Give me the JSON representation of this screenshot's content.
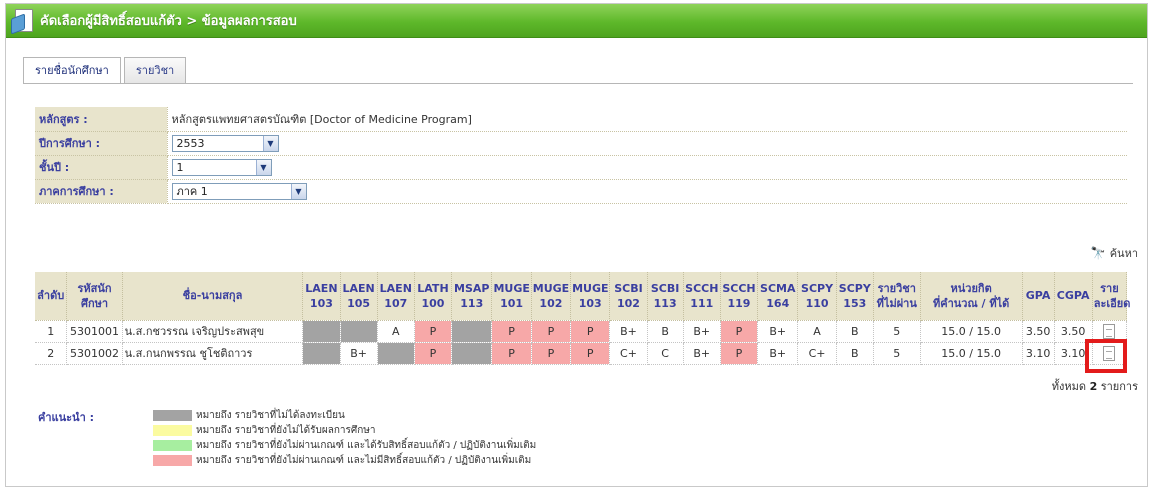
{
  "header": {
    "title": "คัดเลือกผู้มีสิทธิ์สอบแก้ตัว > ข้อมูลผลการสอบ"
  },
  "tabs": [
    {
      "label": "รายชื่อนักศึกษา",
      "active": true
    },
    {
      "label": "รายวิชา",
      "active": false
    }
  ],
  "form": {
    "curriculum_label": "หลักสูตร :",
    "curriculum_value": "หลักสูตรแพทยศาสตรบัณฑิต [Doctor of Medicine Program]",
    "year_label": "ปีการศึกษา :",
    "year_value": "2553",
    "class_label": "ชั้นปี :",
    "class_value": "1",
    "semester_label": "ภาคการศึกษา :",
    "semester_value": "ภาค 1"
  },
  "search": {
    "label": "ค้นหา"
  },
  "table": {
    "headers": {
      "no": "ลำดับ",
      "sid_1": "รหัสนัก",
      "sid_2": "ศึกษา",
      "name": "ชื่อ-นามสกุล",
      "fail_1": "รายวิชา",
      "fail_2": "ที่ไม่ผ่าน",
      "credits_1": "หน่วยกิต",
      "credits_2": "ที่คำนวณ / ที่ได้",
      "gpa": "GPA",
      "cgpa": "CGPA",
      "detail_1": "ราย",
      "detail_2": "ละเอียด"
    },
    "courses": [
      {
        "code": "LAEN",
        "num": "103"
      },
      {
        "code": "LAEN",
        "num": "105"
      },
      {
        "code": "LAEN",
        "num": "107"
      },
      {
        "code": "LATH",
        "num": "100"
      },
      {
        "code": "MSAP",
        "num": "113"
      },
      {
        "code": "MUGE",
        "num": "101"
      },
      {
        "code": "MUGE",
        "num": "102"
      },
      {
        "code": "MUGE",
        "num": "103"
      },
      {
        "code": "SCBI",
        "num": "102"
      },
      {
        "code": "SCBI",
        "num": "113"
      },
      {
        "code": "SCCH",
        "num": "111"
      },
      {
        "code": "SCCH",
        "num": "119"
      },
      {
        "code": "SCMA",
        "num": "164"
      },
      {
        "code": "SCPY",
        "num": "110"
      },
      {
        "code": "SCPY",
        "num": "153"
      }
    ],
    "rows": [
      {
        "no": "1",
        "sid": "5301001",
        "name": "น.ส.กชวรรณ เจริญประสพสุข",
        "grades": [
          "",
          "",
          "A",
          "P",
          "",
          "P",
          "P",
          "P",
          "B+",
          "B",
          "B+",
          "P",
          "B+",
          "A",
          "B"
        ],
        "status": [
          "g",
          "g",
          "",
          "p",
          "g",
          "p",
          "p",
          "p",
          "",
          "",
          "",
          "p",
          "",
          "",
          ""
        ],
        "fail_count": "5",
        "credits": "15.0 / 15.0",
        "gpa": "3.50",
        "cgpa": "3.50"
      },
      {
        "no": "2",
        "sid": "5301002",
        "name": "น.ส.กนกพรรณ ชูโชติถาวร",
        "grades": [
          "",
          "B+",
          "",
          "P",
          "",
          "P",
          "P",
          "P",
          "C+",
          "C",
          "B+",
          "P",
          "B+",
          "C+",
          "B"
        ],
        "status": [
          "g",
          "",
          "g",
          "p",
          "g",
          "p",
          "p",
          "p",
          "",
          "",
          "",
          "p",
          "",
          "",
          ""
        ],
        "fail_count": "5",
        "credits": "15.0 / 15.0",
        "gpa": "3.10",
        "cgpa": "3.10"
      }
    ]
  },
  "footer": {
    "total_prefix": "ทั้งหมด",
    "total_count": "2",
    "total_suffix": "รายการ"
  },
  "legend": {
    "label": "คำแนะนำ :",
    "items": [
      {
        "color": "#a3a3a3",
        "text": "หมายถึง รายวิชาที่ไม่ได้ลงทะเบียน"
      },
      {
        "color": "#fbfba0",
        "text": "หมายถึง รายวิชาที่ยังไม่ได้รับผลการศึกษา"
      },
      {
        "color": "#a7eea0",
        "text": "หมายถึง รายวิชาที่ยังไม่ผ่านเกณฑ์ และได้รับสิทธิ์สอบแก้ตัว / ปฏิบัติงานเพิ่มเติม"
      },
      {
        "color": "#f7a8a8",
        "text": "หมายถึง รายวิชาที่ยังไม่ผ่านเกณฑ์ และไม่มีสิทธิ์สอบแก้ตัว / ปฏิบัติงานเพิ่มเติม"
      }
    ]
  },
  "icons": {
    "header": "document-folder-icon",
    "search": "binoculars-icon",
    "detail": "document-icon"
  }
}
